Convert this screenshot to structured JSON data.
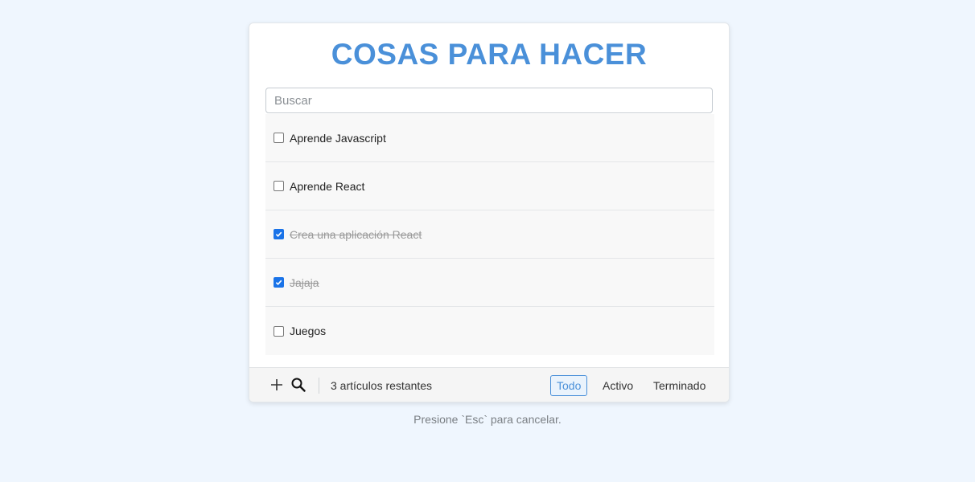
{
  "app": {
    "title": "COSAS PARA HACER"
  },
  "search": {
    "placeholder": "Buscar",
    "value": ""
  },
  "todos": [
    {
      "label": "Aprende Javascript",
      "completed": false
    },
    {
      "label": "Aprende React",
      "completed": false
    },
    {
      "label": "Crea una aplicación React",
      "completed": true
    },
    {
      "label": "Jajaja",
      "completed": true
    },
    {
      "label": "Juegos",
      "completed": false
    }
  ],
  "footer": {
    "add_icon": "plus-icon",
    "search_icon": "search-icon",
    "remaining_text": "3 artículos restantes",
    "filters": [
      {
        "label": "Todo",
        "active": true
      },
      {
        "label": "Activo",
        "active": false
      },
      {
        "label": "Terminado",
        "active": false
      }
    ]
  },
  "hint": "Presione `Esc` para cancelar.",
  "colors": {
    "accent": "#4a90d9",
    "background": "#eff6fe",
    "checkbox_checked": "#1a73e8"
  }
}
